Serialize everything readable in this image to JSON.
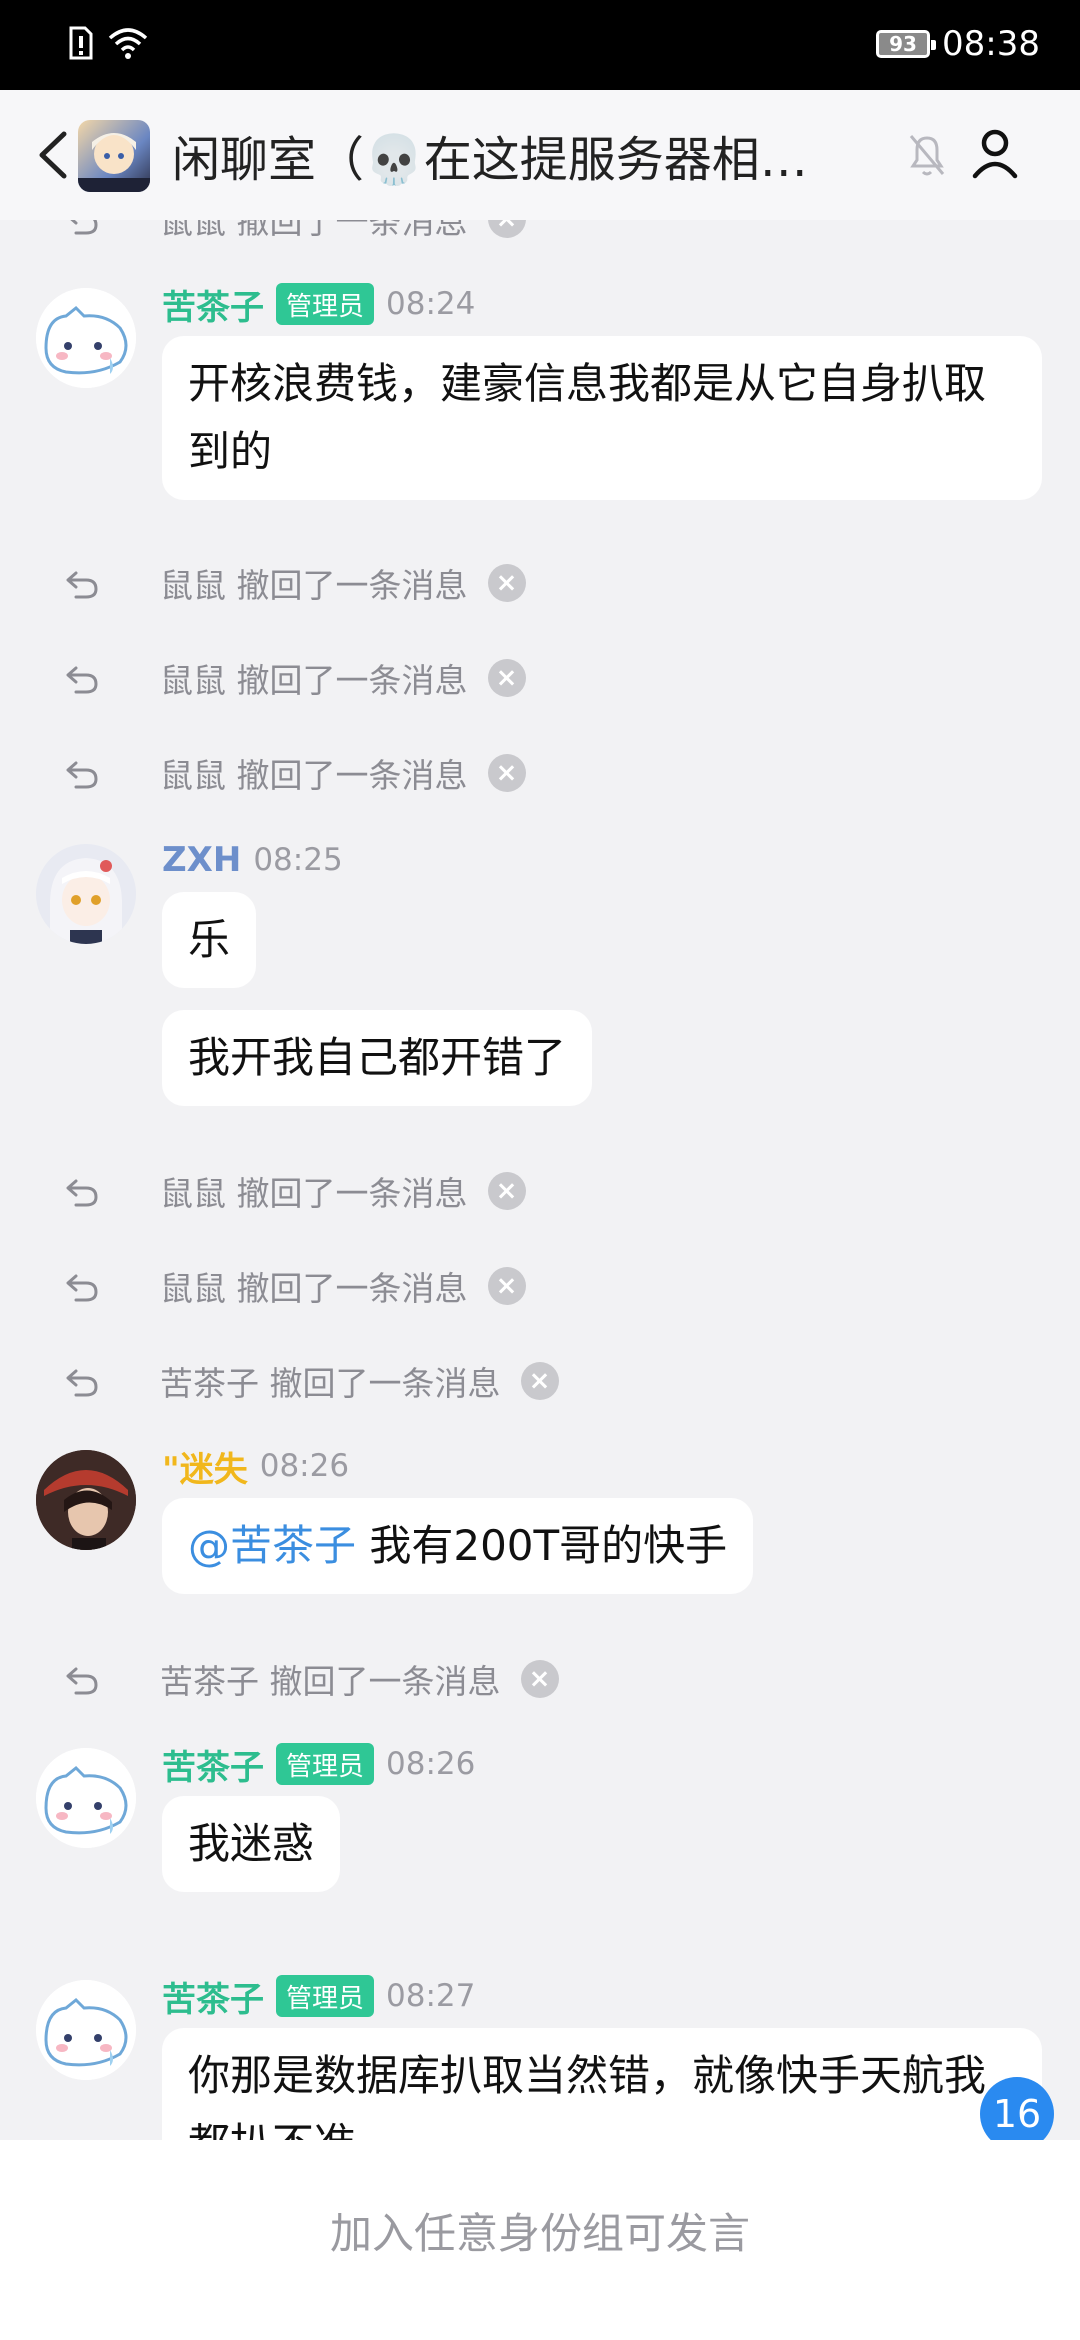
{
  "status": {
    "battery": "93",
    "time": "08:38"
  },
  "header": {
    "title": "闲聊室（💀在这提服务器相关…"
  },
  "messages": {
    "partial_recall": "鼠鼠 撤回了一条消息",
    "m1": {
      "name": "苦茶子",
      "badge": "管理员",
      "time": "08:24",
      "text": "开核浪费钱，建豪信息我都是从它自身扒取到的"
    },
    "r1": "鼠鼠 撤回了一条消息",
    "r2": "鼠鼠 撤回了一条消息",
    "r3": "鼠鼠 撤回了一条消息",
    "m2": {
      "name": "ZXH",
      "time": "08:25",
      "text1": "乐",
      "text2": "我开我自己都开错了"
    },
    "r4": "鼠鼠 撤回了一条消息",
    "r5": "鼠鼠 撤回了一条消息",
    "r6": "苦茶子 撤回了一条消息",
    "m3": {
      "name": "\"迷失",
      "time": "08:26",
      "mention": "@苦茶子",
      "text": " 我有200T哥的快手"
    },
    "r7": "苦茶子 撤回了一条消息",
    "m4": {
      "name": "苦茶子",
      "badge": "管理员",
      "time": "08:26",
      "text": "我迷惑"
    },
    "m5": {
      "name": "苦茶子",
      "badge": "管理员",
      "time": "08:27",
      "text": "你那是数据库扒取当然错，就像快手天航我都扒不准"
    }
  },
  "unread_count": "16",
  "bottom": {
    "placeholder": "加入任意身份组可发言"
  }
}
